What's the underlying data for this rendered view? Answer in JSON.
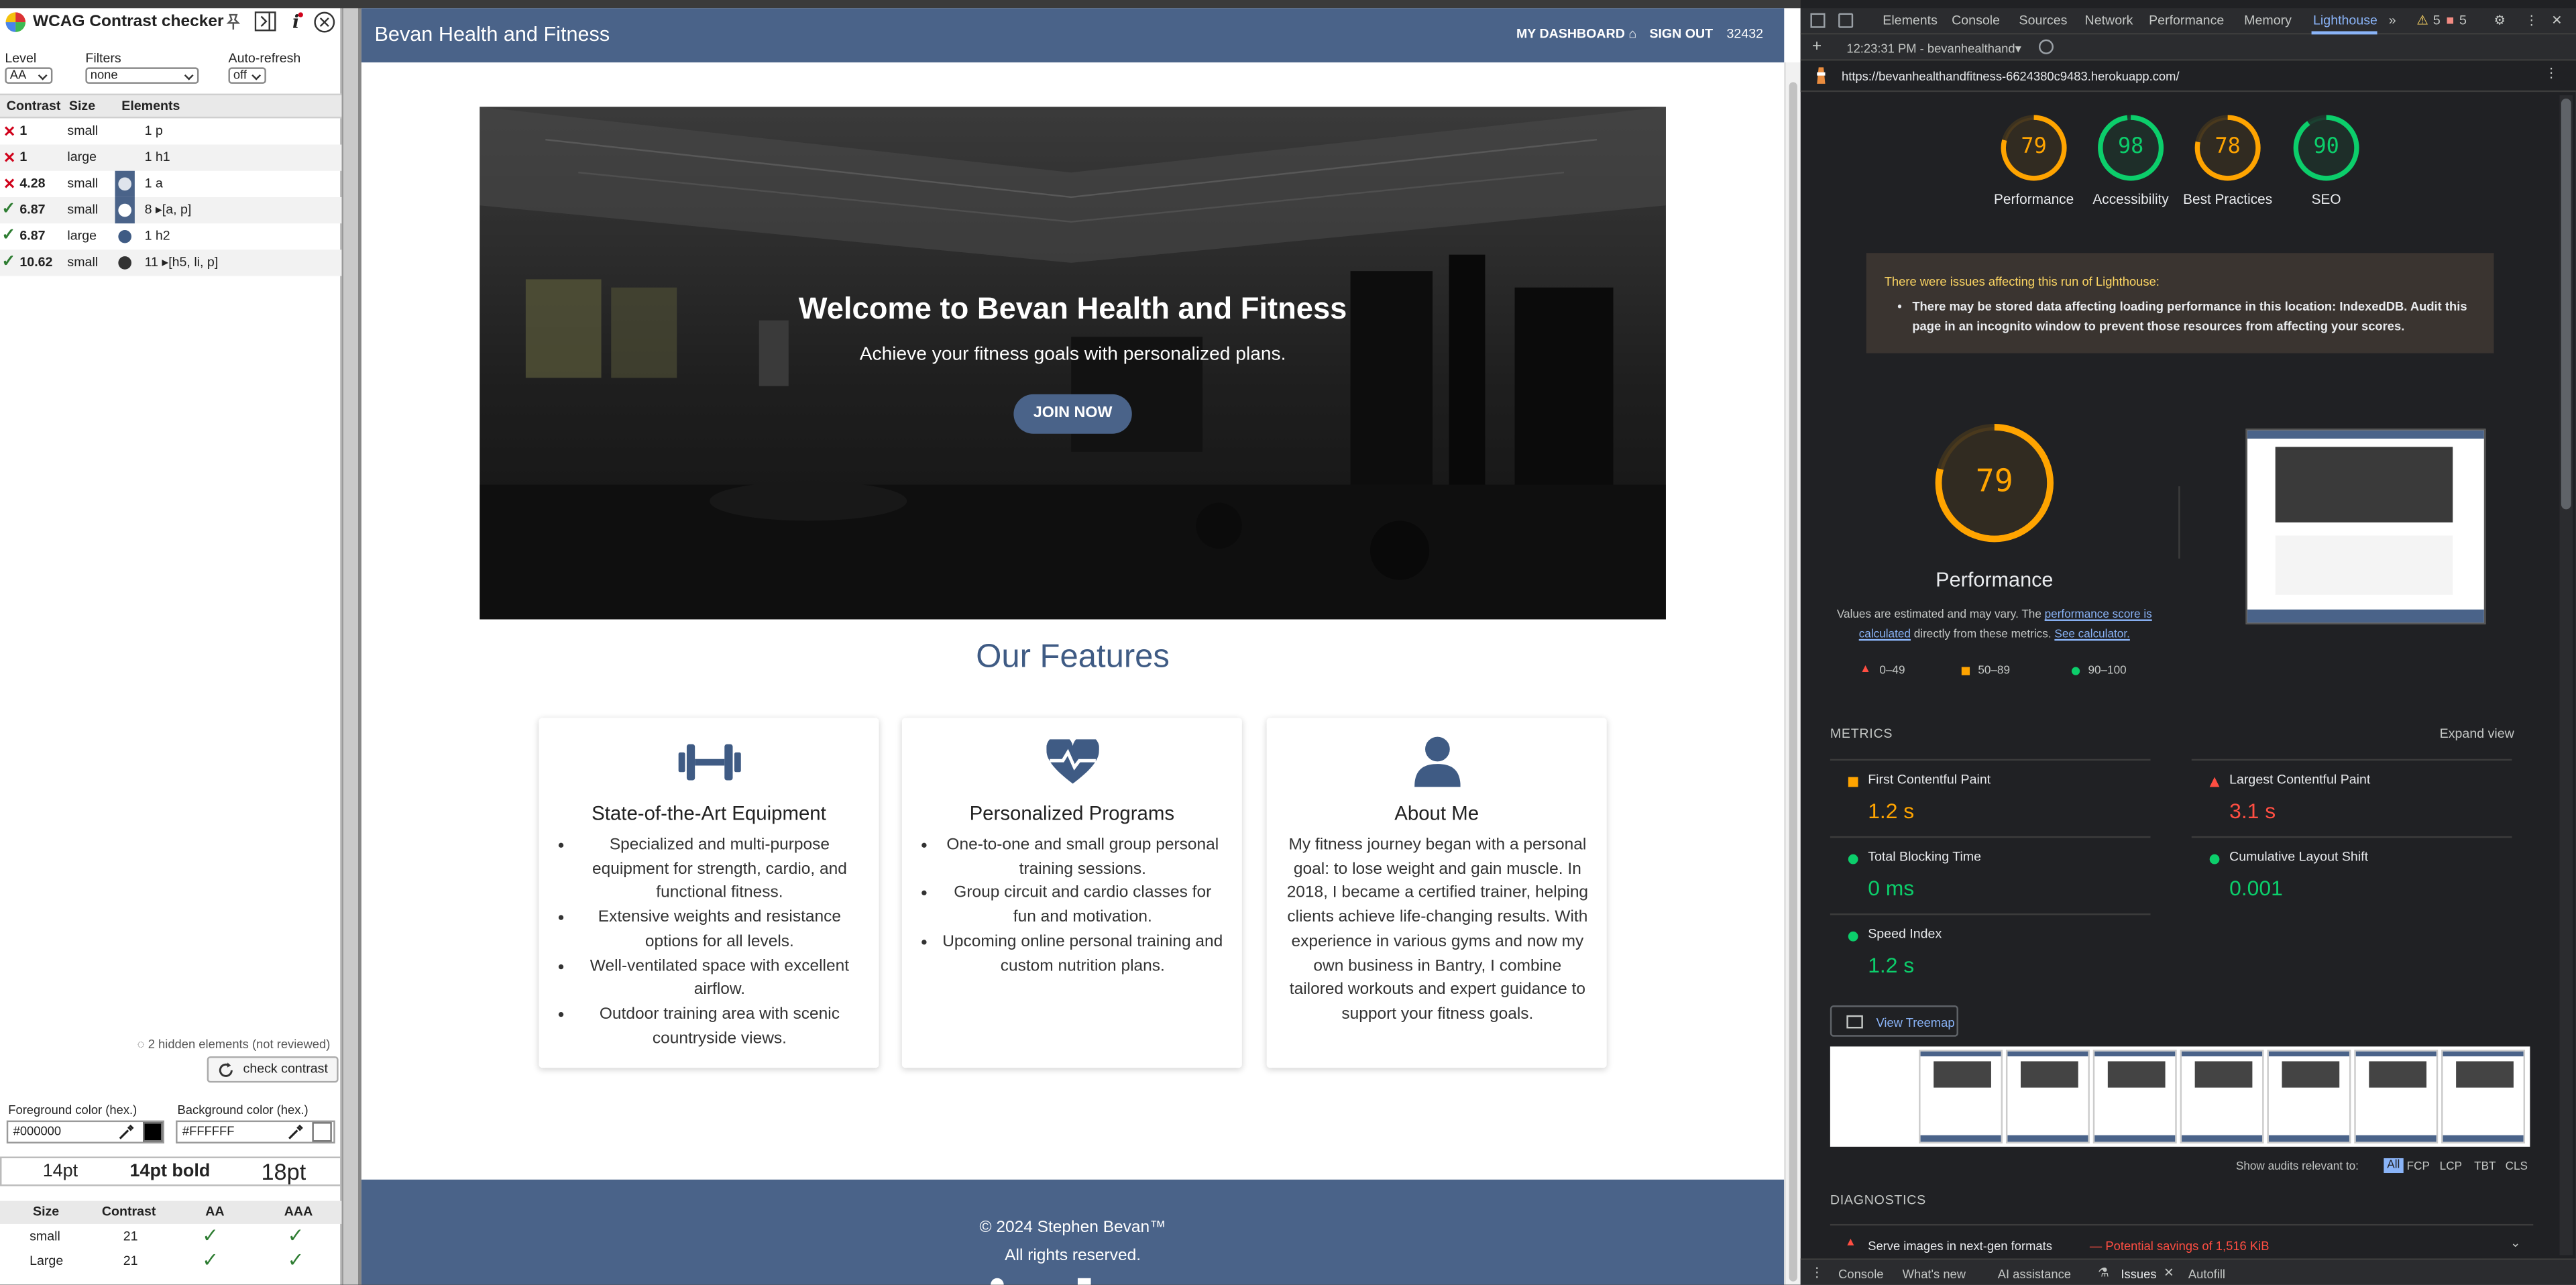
{
  "wcag": {
    "title": "WCAG Contrast checker",
    "level_label": "Level",
    "level_value": "AA",
    "filters_label": "Filters",
    "filters_value": "none",
    "autorefresh_label": "Auto-refresh",
    "autorefresh_value": "off",
    "headers": [
      "Contrast",
      "Size",
      "Elements"
    ],
    "rows": [
      {
        "status": "fail",
        "contrast": "1",
        "size": "small",
        "elements": "1 p",
        "swatch": "",
        "alt": false
      },
      {
        "status": "fail",
        "contrast": "1",
        "size": "large",
        "elements": "1 h1",
        "swatch": "",
        "alt": true
      },
      {
        "status": "fail",
        "contrast": "4.28",
        "size": "small",
        "elements": "1 a",
        "swatch": "#4a6389",
        "alt": false
      },
      {
        "status": "pass",
        "contrast": "6.87",
        "size": "small",
        "elements": "8 ▸[a, p]",
        "swatch": "#4a6389",
        "alt": true
      },
      {
        "status": "pass",
        "contrast": "6.87",
        "size": "large",
        "elements": "1 h2",
        "swatch": "#ffffff",
        "alt": false
      },
      {
        "status": "pass",
        "contrast": "10.62",
        "size": "small",
        "elements": "11 ▸[h5, li, p]",
        "swatch": "#ffffff",
        "alt": true
      }
    ],
    "hidden_note": "2 hidden elements (not reviewed)",
    "check_button": "check contrast",
    "fg_label": "Foreground color (hex.)",
    "fg_value": "#000000",
    "bg_label": "Background color (hex.)",
    "bg_value": "#FFFFFF",
    "samples": [
      "14pt",
      "14pt bold",
      "18pt"
    ],
    "ratio_headers": [
      "Size",
      "Contrast",
      "AA",
      "AAA"
    ],
    "ratio_rows": [
      {
        "size": "small",
        "contrast": "21"
      },
      {
        "size": "Large",
        "contrast": "21"
      }
    ],
    "tick": "✓"
  },
  "site": {
    "brand": "Bevan Health and Fitness",
    "nav": {
      "dashboard": "MY DASHBOARD",
      "signout": "SIGN OUT",
      "user_id": "32432"
    },
    "hero_title": "Welcome to Bevan Health and Fitness",
    "hero_subtitle": "Achieve your fitness goals with personalized plans.",
    "hero_button": "JOIN NOW",
    "features_title": "Our Features",
    "cards": [
      {
        "icon": "dumbbell-icon",
        "title": "State-of-the-Art Equipment",
        "items": [
          "Specialized and multi-purpose equipment for strength, cardio, and functional fitness.",
          "Extensive weights and resistance options for all levels.",
          "Well-ventilated space with excellent airflow.",
          "Outdoor training area with scenic countryside views."
        ]
      },
      {
        "icon": "heartbeat-icon",
        "title": "Personalized Programs",
        "items": [
          "One-to-one and small group personal training sessions.",
          "Group circuit and cardio classes for fun and motivation.",
          "Upcoming online personal training and custom nutrition plans."
        ]
      },
      {
        "icon": "user-icon",
        "title": "About Me",
        "text": "My fitness journey began with a personal goal: to lose weight and gain muscle. In 2018, I became a certified trainer, helping clients achieve life-changing results. With experience in various gyms and now my own business in Bantry, I combine tailored workouts and expert guidance to support your fitness goals."
      }
    ],
    "footer_copy": "© 2024 Stephen Bevan™",
    "footer_rights": "All rights reserved.",
    "brand_color": "#4a6389"
  },
  "devtools": {
    "tabs": [
      "Elements",
      "Console",
      "Sources",
      "Network",
      "Performance",
      "Memory",
      "Lighthouse"
    ],
    "active_tab": "Lighthouse",
    "warn_count": "5",
    "err_count": "5",
    "timestamp": "12:23:31 PM - bevanhealthand▾",
    "url": "https://bevanhealthandfitness-6624380c9483.herokuapp.com/",
    "scores": [
      {
        "label": "Performance",
        "value": 79,
        "color": "#ffa400"
      },
      {
        "label": "Accessibility",
        "value": 98,
        "color": "#0cce6b"
      },
      {
        "label": "Best Practices",
        "value": 78,
        "color": "#ffa400"
      },
      {
        "label": "SEO",
        "value": 90,
        "color": "#0cce6b"
      }
    ],
    "issue_title": "There were issues affecting this run of Lighthouse:",
    "issue_text": "There may be stored data affecting loading performance in this location: IndexedDB. Audit this page in an incognito window to prevent those resources from affecting your scores.",
    "perf_score": 79,
    "perf_label": "Performance",
    "perf_note_1": "Values are estimated and may vary. The ",
    "perf_note_link": "performance score is calculated",
    "perf_note_2": " directly from these metrics. ",
    "perf_note_calc": "See calculator.",
    "legend": [
      "0–49",
      "50–89",
      "90–100"
    ],
    "metrics_label": "METRICS",
    "expand_view": "Expand view",
    "metrics": [
      {
        "name": "First Contentful Paint",
        "value": "1.2 s",
        "status": "orange"
      },
      {
        "name": "Largest Contentful Paint",
        "value": "3.1 s",
        "status": "red"
      },
      {
        "name": "Total Blocking Time",
        "value": "0 ms",
        "status": "green"
      },
      {
        "name": "Cumulative Layout Shift",
        "value": "0.001",
        "status": "green"
      },
      {
        "name": "Speed Index",
        "value": "1.2 s",
        "status": "green"
      }
    ],
    "treemap": "View Treemap",
    "show_audits": "Show audits relevant to:",
    "filters": [
      "All",
      "FCP",
      "LCP",
      "TBT",
      "CLS"
    ],
    "diagnostics": "DIAGNOSTICS",
    "diag_item": "Serve images in next-gen formats",
    "diag_savings": "— Potential savings of 1,516 KiB",
    "bottom_tabs": [
      "Console",
      "What's new",
      "AI assistance",
      "Issues",
      "Autofill"
    ]
  }
}
